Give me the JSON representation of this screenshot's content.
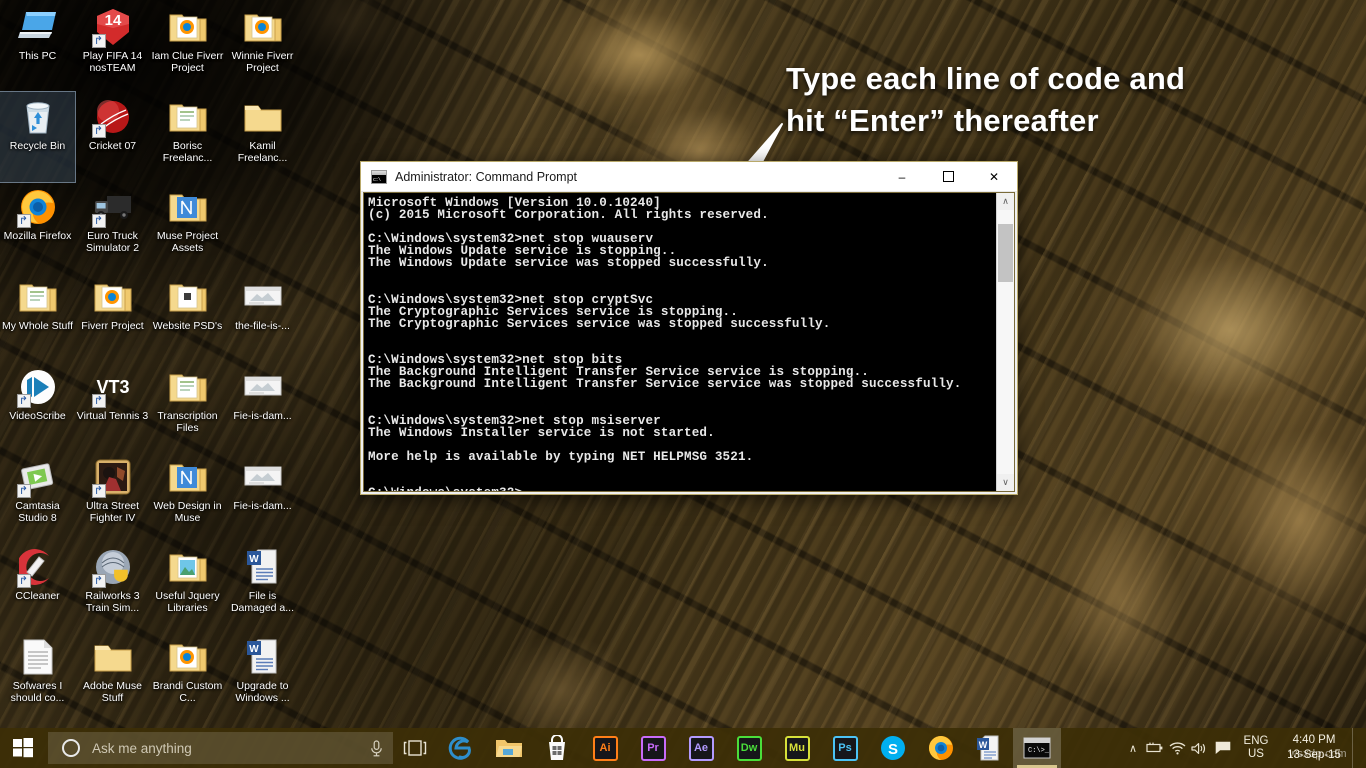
{
  "desktop": {
    "icons": [
      {
        "label": "This PC",
        "icon": "monitor-icon",
        "shortcut": false,
        "selected": false
      },
      {
        "label": "Play FIFA 14 nosTEAM",
        "icon": "fifa-game-icon",
        "shortcut": true,
        "selected": false
      },
      {
        "label": "Iam Clue Fiverr Project",
        "icon": "folder-firefox-icon",
        "shortcut": false,
        "selected": false
      },
      {
        "label": "Winnie Fiverr Project",
        "icon": "folder-firefox-icon",
        "shortcut": false,
        "selected": false
      },
      {
        "label": "Recycle Bin",
        "icon": "recycle-bin-icon",
        "shortcut": false,
        "selected": true
      },
      {
        "label": "Cricket 07",
        "icon": "cricket-ball-icon",
        "shortcut": true,
        "selected": false
      },
      {
        "label": "Borisc Freelanc...",
        "icon": "folder-doc-icon",
        "shortcut": false,
        "selected": false
      },
      {
        "label": "Kamil Freelanc...",
        "icon": "folder-icon",
        "shortcut": false,
        "selected": false
      },
      {
        "label": "Mozilla Firefox",
        "icon": "firefox-icon",
        "shortcut": true,
        "selected": false
      },
      {
        "label": "Euro Truck Simulator 2",
        "icon": "truck-icon",
        "shortcut": true,
        "selected": false
      },
      {
        "label": "Muse Project Assets",
        "icon": "folder-muse-icon",
        "shortcut": false,
        "selected": false
      },
      {
        "label": "",
        "icon": "none",
        "shortcut": false,
        "selected": false
      },
      {
        "label": "My Whole Stuff",
        "icon": "folder-doc-icon",
        "shortcut": false,
        "selected": false
      },
      {
        "label": "Fiverr Project",
        "icon": "folder-firefox-icon",
        "shortcut": false,
        "selected": false
      },
      {
        "label": "Website PSD's",
        "icon": "folder-ps-icon",
        "shortcut": false,
        "selected": false
      },
      {
        "label": "the-file-is-...",
        "icon": "file-image-icon",
        "shortcut": false,
        "selected": false
      },
      {
        "label": "VideoScribe",
        "icon": "videoscribe-icon",
        "shortcut": true,
        "selected": false
      },
      {
        "label": "Virtual Tennis 3",
        "icon": "vt3-icon",
        "shortcut": true,
        "selected": false
      },
      {
        "label": "Transcription Files",
        "icon": "folder-doc-icon",
        "shortcut": false,
        "selected": false
      },
      {
        "label": "Fie-is-dam...",
        "icon": "file-image-icon",
        "shortcut": false,
        "selected": false
      },
      {
        "label": "Camtasia Studio 8",
        "icon": "camtasia-icon",
        "shortcut": true,
        "selected": false
      },
      {
        "label": "Ultra Street Fighter IV",
        "icon": "street-fighter-icon",
        "shortcut": true,
        "selected": false
      },
      {
        "label": "Web Design in Muse",
        "icon": "folder-muse-icon",
        "shortcut": false,
        "selected": false
      },
      {
        "label": "Fie-is-dam...",
        "icon": "file-image-icon",
        "shortcut": false,
        "selected": false
      },
      {
        "label": "CCleaner",
        "icon": "ccleaner-icon",
        "shortcut": true,
        "selected": false
      },
      {
        "label": "Railworks 3 Train Sim...",
        "icon": "railworks-icon",
        "shortcut": true,
        "selected": false
      },
      {
        "label": "Useful Jquery Libraries",
        "icon": "folder-image-icon",
        "shortcut": false,
        "selected": false
      },
      {
        "label": "File is Damaged a...",
        "icon": "word-doc-icon",
        "shortcut": false,
        "selected": false
      },
      {
        "label": "Sofwares I should co...",
        "icon": "text-file-icon",
        "shortcut": false,
        "selected": false
      },
      {
        "label": "Adobe Muse Stuff",
        "icon": "folder-icon",
        "shortcut": false,
        "selected": false
      },
      {
        "label": "Brandi Custom C...",
        "icon": "folder-firefox-icon",
        "shortcut": false,
        "selected": false
      },
      {
        "label": "Upgrade to Windows ...",
        "icon": "word-doc-icon",
        "shortcut": false,
        "selected": false
      }
    ]
  },
  "annotation": {
    "line1": "Type each line of code and",
    "line2": "hit “Enter” thereafter",
    "arrow": "down-left-arrow-icon"
  },
  "cmd_window": {
    "title": "Administrator: Command Prompt",
    "icon": "console-icon",
    "minimize": "–",
    "maximize": "☐",
    "close": "✕",
    "scroll_up": "∧",
    "scroll_down": "∨",
    "console_text": "Microsoft Windows [Version 10.0.10240]\n(c) 2015 Microsoft Corporation. All rights reserved.\n\nC:\\Windows\\system32>net stop wuauserv\nThe Windows Update service is stopping..\nThe Windows Update service was stopped successfully.\n\n\nC:\\Windows\\system32>net stop cryptSvc\nThe Cryptographic Services service is stopping..\nThe Cryptographic Services service was stopped successfully.\n\n\nC:\\Windows\\system32>net stop bits\nThe Background Intelligent Transfer Service service is stopping..\nThe Background Intelligent Transfer Service service was stopped successfully.\n\n\nC:\\Windows\\system32>net stop msiserver\nThe Windows Installer service is not started.\n\nMore help is available by typing NET HELPMSG 3521.\n\n\nC:\\Windows\\system32>"
  },
  "taskbar": {
    "start": "windows-logo-icon",
    "search_placeholder": "Ask me anything",
    "mic": "microphone-icon",
    "task_view": "task-view-icon",
    "apps": [
      {
        "name": "edge",
        "label": "e",
        "color": "#2e8ecb",
        "kind": "edge"
      },
      {
        "name": "file-explorer",
        "label": "",
        "color": "#e8b44a",
        "kind": "explorer"
      },
      {
        "name": "store",
        "label": "",
        "color": "#ffffff",
        "kind": "store"
      },
      {
        "name": "illustrator",
        "label": "Ai",
        "color": "#ff7f18",
        "kind": "adobe"
      },
      {
        "name": "premiere-pro",
        "label": "Pr",
        "color": "#c86bfa",
        "kind": "adobe"
      },
      {
        "name": "after-effects",
        "label": "Ae",
        "color": "#b39aff",
        "kind": "adobe"
      },
      {
        "name": "dreamweaver",
        "label": "Dw",
        "color": "#4ade3a",
        "kind": "adobe"
      },
      {
        "name": "muse",
        "label": "Mu",
        "color": "#d6e03a",
        "kind": "adobe"
      },
      {
        "name": "photoshop",
        "label": "Ps",
        "color": "#4bc3f5",
        "kind": "adobe"
      },
      {
        "name": "skype",
        "label": "S",
        "color": "#00aff0",
        "kind": "skype"
      },
      {
        "name": "firefox",
        "label": "",
        "color": "#e66000",
        "kind": "firefox"
      },
      {
        "name": "word",
        "label": "W",
        "color": "#2b579a",
        "kind": "word"
      },
      {
        "name": "command-prompt",
        "label": "",
        "color": "#000000",
        "kind": "cmd",
        "active": true
      }
    ],
    "tray": {
      "chevron": "∧",
      "battery": "battery-icon",
      "wifi": "wifi-icon",
      "volume": "volume-icon",
      "action_center": "action-center-icon",
      "lang_line1": "ENG",
      "lang_line2": "US",
      "time": "4:40 PM",
      "date": "13-Sep-15",
      "watermark": "wsxdp.com"
    }
  }
}
